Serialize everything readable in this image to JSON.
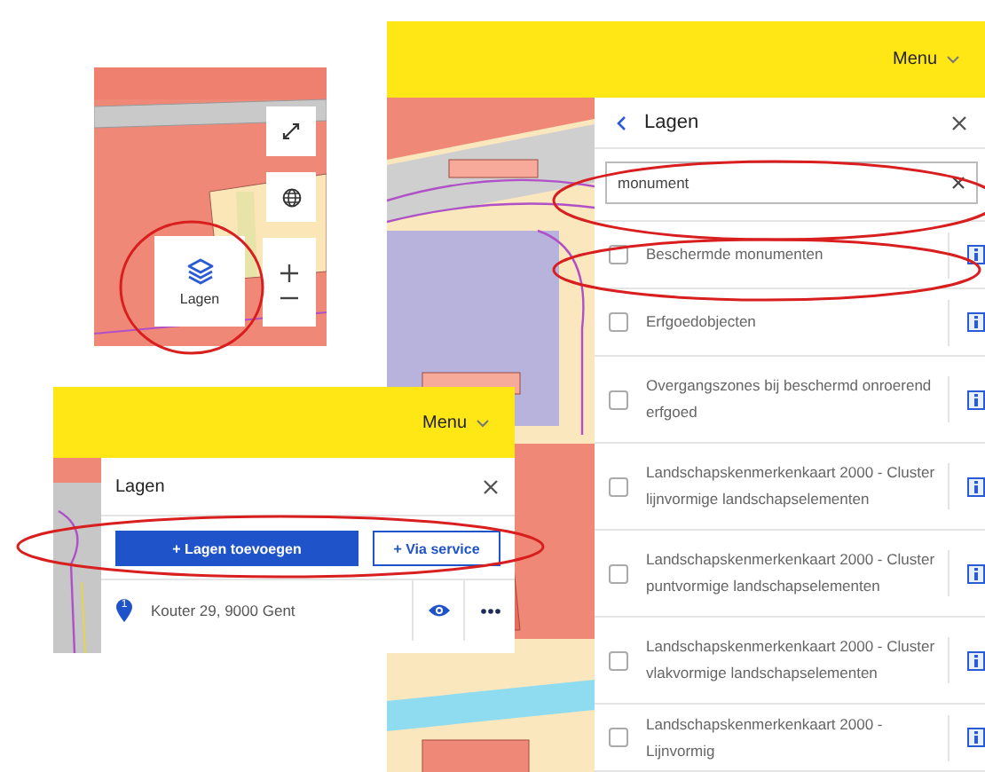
{
  "map_snippet": {
    "layers_button": {
      "label": "Lagen"
    }
  },
  "layers_panel_search": {
    "menu": "Menu",
    "title": "Lagen",
    "search": {
      "value": "monument"
    },
    "results": [
      {
        "name": "Beschermde monumenten",
        "checked": false
      },
      {
        "name": "Erfgoedobjecten",
        "checked": false
      },
      {
        "name": "Overgangszones bij beschermd onroerend erfgoed",
        "checked": false
      },
      {
        "name": "Landschapskenmerkenkaart 2000 - Cluster lijnvormige landschapselementen",
        "checked": false
      },
      {
        "name": "Landschapskenmerkenkaart 2000 - Cluster puntvormige landschapselementen",
        "checked": false
      },
      {
        "name": "Landschapskenmerkenkaart 2000 - Cluster vlakvormige landschapselementen",
        "checked": false
      },
      {
        "name": "Landschapskenmerkenkaart 2000 - Lijnvormig",
        "checked": false
      }
    ]
  },
  "layers_panel_small": {
    "menu": "Menu",
    "title": "Lagen",
    "add_button": "+ Lagen toevoegen",
    "service_button": "+ Via service",
    "layers": [
      {
        "marker": "1",
        "name": "Kouter 29, 9000 Gent"
      }
    ]
  }
}
